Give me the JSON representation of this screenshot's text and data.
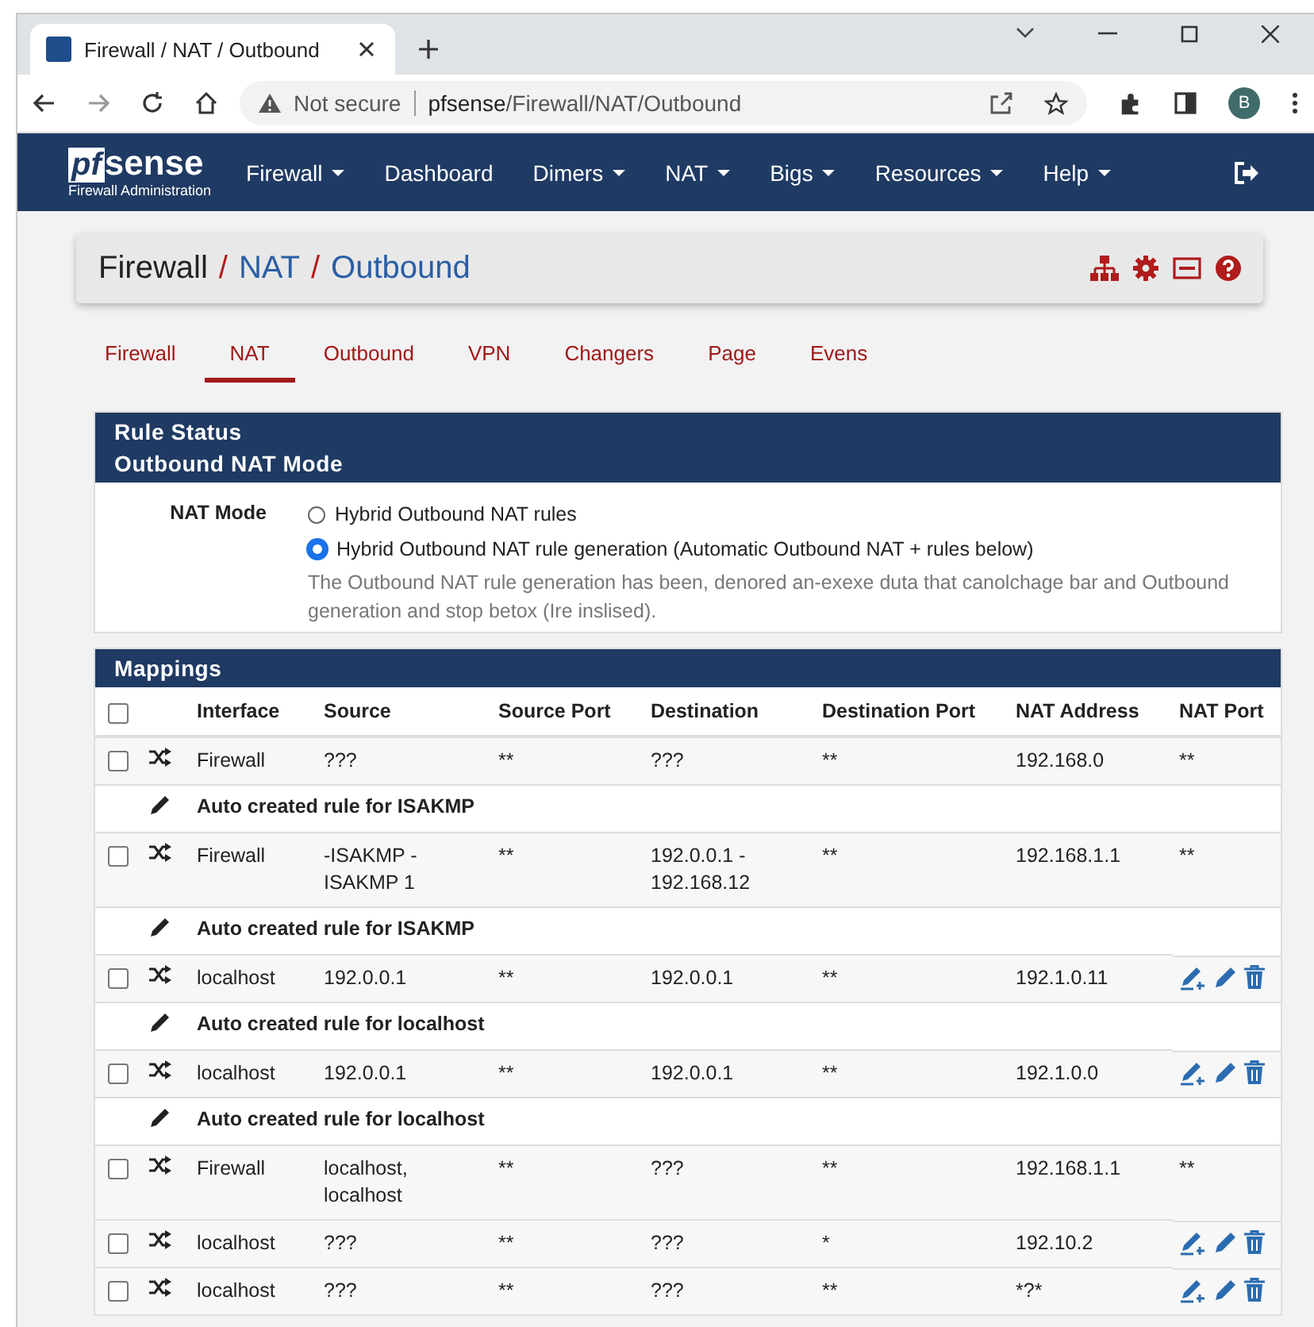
{
  "browser": {
    "tab_title": "Firewall / NAT / Outbound",
    "security": "Not secure",
    "url_host": "pfsense",
    "url_path": "/Firewall/NAT/Outbound",
    "profile": "B"
  },
  "navbar": {
    "logo_pf": "pf",
    "logo_sense": "sense",
    "logo_sub": "Firewall Administration",
    "menus": [
      {
        "label": "Firewall",
        "dropdown": true
      },
      {
        "label": "Dashboard",
        "dropdown": false
      },
      {
        "label": "Dimers",
        "dropdown": true
      },
      {
        "label": "NAT",
        "dropdown": true
      },
      {
        "label": "Bigs",
        "dropdown": true
      },
      {
        "label": "Resources",
        "dropdown": true
      },
      {
        "label": "Help",
        "dropdown": true
      }
    ]
  },
  "breadcrumb_separator": "/",
  "breadcrumb": [
    {
      "label": "Firewall",
      "link": false
    },
    {
      "label": "NAT",
      "link": true
    },
    {
      "label": "Outbound",
      "link": true
    }
  ],
  "tabs": [
    {
      "label": "Firewall",
      "selected": false
    },
    {
      "label": "NAT",
      "selected": true
    },
    {
      "label": "Outbound",
      "selected": false
    },
    {
      "label": "VPN",
      "selected": false
    },
    {
      "label": "Changers",
      "selected": false
    },
    {
      "label": "Page",
      "selected": false
    },
    {
      "label": "Evens",
      "selected": false
    }
  ],
  "mode_panel": {
    "title": "Rule Status",
    "subtitle": "Outbound NAT Mode",
    "label": "NAT Mode",
    "options": [
      {
        "label": "Hybrid Outbound NAT rules",
        "selected": false
      },
      {
        "label": "Hybrid Outbound NAT rule generation (Automatic Outbound NAT + rules below)",
        "selected": true
      }
    ],
    "help": "The Outbound NAT rule generation has been, denored an-exexe duta that canolchage bar and Outbound generation and stop betox (Ire inslised)."
  },
  "mappings": {
    "title": "Mappings",
    "select_all_checked": false,
    "columns": [
      "Interface",
      "Source",
      "Source Port",
      "Destination",
      "Destination Port",
      "NAT Address",
      "NAT Port"
    ],
    "rows": [
      {
        "kind": "rule",
        "checked": false,
        "interface": "Firewall",
        "source": [
          "???"
        ],
        "source_port": "**",
        "destination": [
          "???"
        ],
        "destination_port": "**",
        "nat_address": "192.168.0",
        "nat_port": "**",
        "actions": false
      },
      {
        "kind": "note",
        "text": "Auto created rule for ISAKMP"
      },
      {
        "kind": "rule",
        "checked": false,
        "interface": "Firewall",
        "source": [
          "-ISAKMP -",
          "ISAKMP 1"
        ],
        "source_port": "**",
        "destination": [
          "192.0.0.1 -",
          "192.168.12"
        ],
        "destination_port": "**",
        "nat_address": "192.168.1.1",
        "nat_port": "**",
        "actions": false
      },
      {
        "kind": "note",
        "text": "Auto created rule for ISAKMP"
      },
      {
        "kind": "rule",
        "checked": false,
        "interface": "localhost",
        "source": [
          "192.0.0.1"
        ],
        "source_port": "**",
        "destination": [
          "192.0.0.1"
        ],
        "destination_port": "**",
        "nat_address": "192.1.0.11",
        "actions": true
      },
      {
        "kind": "note",
        "text": "Auto created rule for localhost"
      },
      {
        "kind": "rule",
        "checked": false,
        "interface": "localhost",
        "source": [
          "192.0.0.1"
        ],
        "source_port": "**",
        "destination": [
          "192.0.0.1"
        ],
        "destination_port": "**",
        "nat_address": "192.1.0.0",
        "actions": true
      },
      {
        "kind": "note",
        "text": "Auto created rule for localhost"
      },
      {
        "kind": "rule",
        "checked": false,
        "interface": "Firewall",
        "source": [
          "localhost,",
          "localhost"
        ],
        "source_port": "**",
        "destination": [
          "???"
        ],
        "destination_port": "**",
        "nat_address": "192.168.1.1",
        "nat_port": "**",
        "actions": false
      },
      {
        "kind": "rule",
        "checked": false,
        "interface": "localhost",
        "source": [
          "???"
        ],
        "source_port": "**",
        "destination": [
          "???"
        ],
        "destination_port": "*",
        "nat_address": "192.10.2",
        "actions": true
      },
      {
        "kind": "rule",
        "checked": false,
        "interface": "localhost",
        "source": [
          "???"
        ],
        "source_port": "**",
        "destination": [
          "???"
        ],
        "destination_port": "**",
        "nat_address": "*?*",
        "actions": true
      }
    ]
  }
}
